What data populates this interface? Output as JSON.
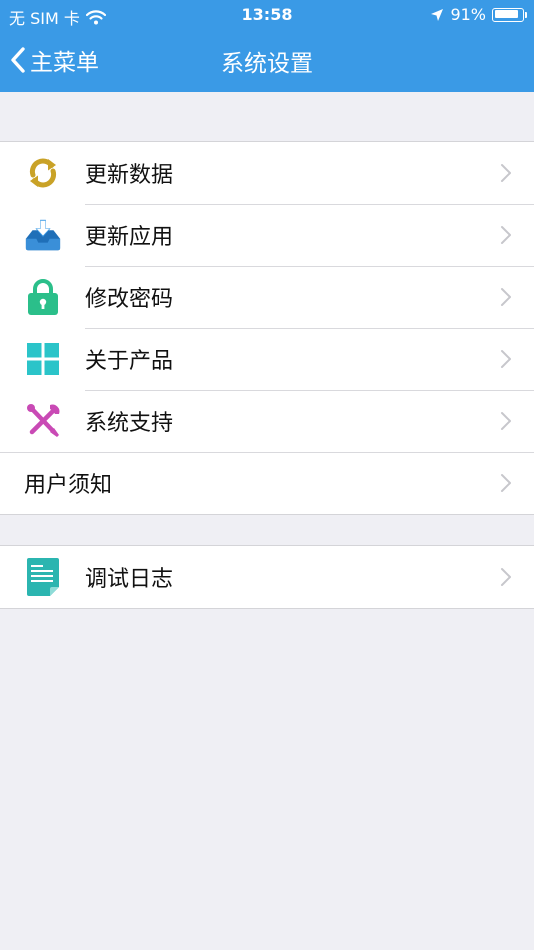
{
  "status_bar": {
    "carrier": "无 SIM 卡",
    "time": "13:58",
    "battery_percent": "91%",
    "battery_level": 0.91
  },
  "nav": {
    "back_label": "主菜单",
    "title": "系统设置"
  },
  "settings_group_1": [
    {
      "label": "更新数据",
      "icon": "refresh-icon"
    },
    {
      "label": "更新应用",
      "icon": "download-tray-icon"
    },
    {
      "label": "修改密码",
      "icon": "lock-icon"
    },
    {
      "label": "关于产品",
      "icon": "grid-icon"
    },
    {
      "label": "系统支持",
      "icon": "tools-icon"
    },
    {
      "label": "用户须知",
      "icon": ""
    }
  ],
  "settings_group_2": [
    {
      "label": "调试日志",
      "icon": "document-icon"
    }
  ],
  "colors": {
    "accent": "#3a9ae6",
    "background": "#efeff4"
  }
}
